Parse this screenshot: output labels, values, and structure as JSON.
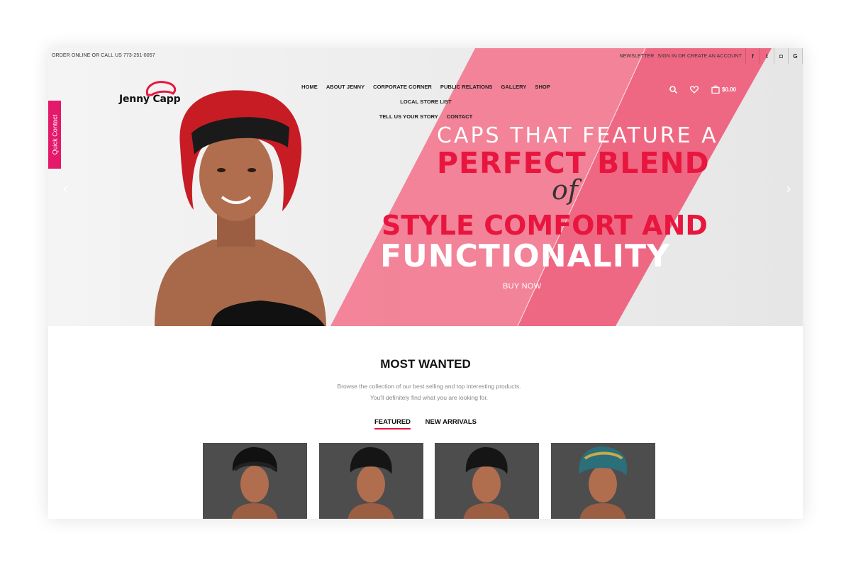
{
  "topbar": {
    "contact": "ORDER ONLINE OR CALL US 773-251-0057",
    "newsletter": "NEWSLETTER",
    "signin": "SIGN IN OR CREATE AN ACCOUNT",
    "social": [
      {
        "icon": "facebook-icon",
        "glyph": "f"
      },
      {
        "icon": "twitter-icon",
        "glyph": "t"
      },
      {
        "icon": "instagram-icon",
        "glyph": "◘"
      },
      {
        "icon": "google-icon",
        "glyph": "G"
      }
    ]
  },
  "logo": {
    "text": "Jenny Capp"
  },
  "nav": {
    "items": [
      "HOME",
      "ABOUT JENNY",
      "CORPORATE CORNER",
      "PUBLIC RELATIONS",
      "GALLERY",
      "SHOP",
      "LOCAL STORE LIST",
      "TELL US YOUR STORY",
      "CONTACT"
    ]
  },
  "tools": {
    "cart_count": "0",
    "cart_amount": "$0.00"
  },
  "quick_contact": "Quick Contact",
  "hero": {
    "line1": "CAPS THAT FEATURE A",
    "line2": "PERFECT BLEND",
    "line3": "of",
    "line4": "STYLE COMFORT AND",
    "line5": "FUNCTIONALITY",
    "cta": "BUY NOW",
    "arrow_prev": "‹",
    "arrow_next": "›"
  },
  "most_wanted": {
    "title": "MOST WANTED",
    "desc1": "Browse the collection of our best selling and top interesting products.",
    "desc2": "You'll definitely find what you are looking for.",
    "tabs": [
      "FEATURED",
      "NEW ARRIVALS"
    ]
  },
  "colors": {
    "accent": "#e8163f",
    "pink_band": "#f2788e",
    "quick_contact": "#e5196a"
  }
}
